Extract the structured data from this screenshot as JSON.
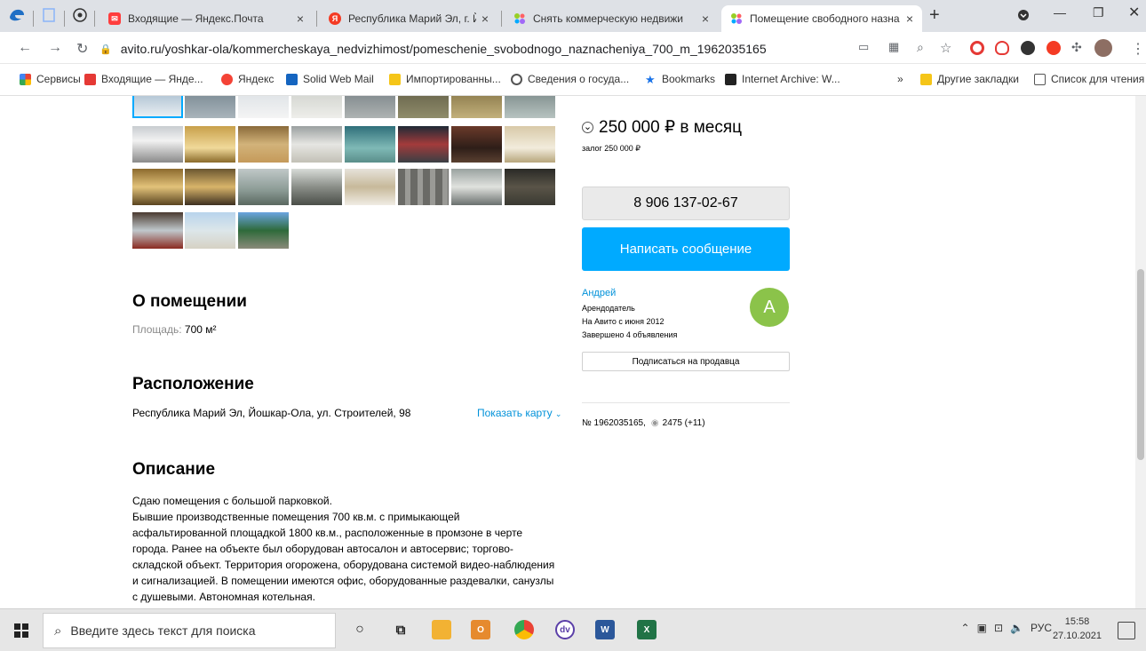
{
  "browser": {
    "tabs": [
      {
        "title": "Входящие — Яндекс.Почта",
        "close": "×"
      },
      {
        "title": "Республика Марий Эл, г. Йошка",
        "close": "×"
      },
      {
        "title": "Снять коммерческую недвижи",
        "close": "×"
      },
      {
        "title": "Помещение свободного назна",
        "close": "×"
      }
    ],
    "new_tab": "+",
    "url": "avito.ru/yoshkar-ola/kommercheskaya_nedvizhimost/pomeschenie_svobodnogo_naznacheniya_700_m_1962035165",
    "bookmarks": [
      {
        "label": "Сервисы",
        "color": "#ea4335"
      },
      {
        "label": "Входящие — Янде...",
        "color": "#e53935"
      },
      {
        "label": "Яндекс",
        "color": "#f44336"
      },
      {
        "label": "Solid Web Mail",
        "color": "#1565c0"
      },
      {
        "label": "Импортированны...",
        "color": "#f5c518"
      },
      {
        "label": "Сведения о госуда...",
        "color": "#555555"
      },
      {
        "label": "Bookmarks",
        "color": "#1a73e8"
      },
      {
        "label": "Internet Archive: W...",
        "color": "#222222"
      }
    ],
    "bookmarks_more": "»",
    "bookmarks_other": "Другие закладки",
    "reading_list": "Список для чтения"
  },
  "listing": {
    "price": "250 000 ₽ в месяц",
    "deposit": "залог 250 000 ₽",
    "phone": "8 906 137-02-67",
    "message_button": "Написать сообщение",
    "seller": {
      "name": "Андрей",
      "role": "Арендодатель",
      "since": "На Авито с июня 2012",
      "completed": "Завершено 4 объявления",
      "avatar_letter": "A"
    },
    "subscribe_button": "Подписаться на продавца",
    "listing_id": "№ 1962035165,",
    "views": "2475 (+11)"
  },
  "about": {
    "title": "О помещении",
    "area_label": "Площадь:",
    "area_value": "700 м²"
  },
  "location": {
    "title": "Расположение",
    "address": "Республика Марий Эл, Йошкар-Ола, ул. Строителей, 98",
    "show_map": "Показать карту"
  },
  "description": {
    "title": "Описание",
    "lines": [
      "Сдаю помещения с большой парковкой.",
      "Бывшие производственные помещения 700 кв.м. с примыкающей",
      "асфальтированной площадкой 1800 кв.м., расположенные в промзоне в черте",
      "города. Ранее на объекте был оборудован автосалон и автосервис; торгово-",
      "складской объект. Территория огорожена, оборудована системой видео-наблюдения",
      "и сигнализацией. В помещении имеются офис, оборудованные раздевалки, санузлы",
      "с душевыми. Автономная котельная."
    ]
  },
  "taskbar": {
    "search_placeholder": "Введите здесь текст для поиска",
    "lang": "РУС",
    "time": "15:58",
    "date": "27.10.2021"
  }
}
